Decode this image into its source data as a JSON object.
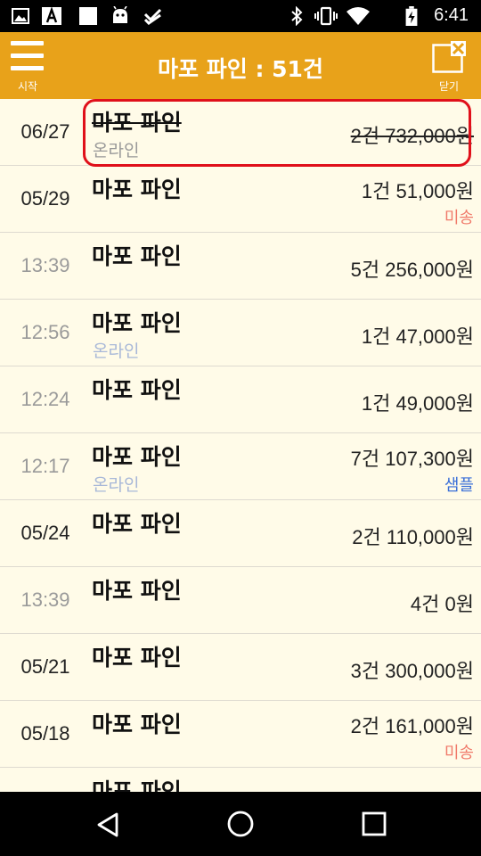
{
  "header": {
    "menu_caption": "시작",
    "title": "마포 파인 : 51건",
    "close_caption": "닫기"
  },
  "status": {
    "time": "6:41"
  },
  "rows": [
    {
      "time": "06/27",
      "time_type": "date",
      "name": "마포 파인",
      "sub": "온라인",
      "amount": "2건 732,000원",
      "badge": "",
      "cancelled": true
    },
    {
      "time": "05/29",
      "time_type": "date",
      "name": "마포 파인",
      "sub": "",
      "amount": "1건 51,000원",
      "badge": "미송",
      "cancelled": false
    },
    {
      "time": "13:39",
      "time_type": "clock",
      "name": "마포 파인",
      "sub": "",
      "amount": "5건 256,000원",
      "badge": "",
      "cancelled": false
    },
    {
      "time": "12:56",
      "time_type": "clock",
      "name": "마포 파인",
      "sub": "온라인",
      "amount": "1건 47,000원",
      "badge": "",
      "cancelled": false
    },
    {
      "time": "12:24",
      "time_type": "clock",
      "name": "마포 파인",
      "sub": "",
      "amount": "1건 49,000원",
      "badge": "",
      "cancelled": false
    },
    {
      "time": "12:17",
      "time_type": "clock",
      "name": "마포 파인",
      "sub": "온라인",
      "amount": "7건 107,300원",
      "badge": "샘플",
      "cancelled": false
    },
    {
      "time": "05/24",
      "time_type": "date",
      "name": "마포 파인",
      "sub": "",
      "amount": "2건 110,000원",
      "badge": "",
      "cancelled": false
    },
    {
      "time": "13:39",
      "time_type": "clock",
      "name": "마포 파인",
      "sub": "",
      "amount": "4건 0원",
      "badge": "",
      "cancelled": false
    },
    {
      "time": "05/21",
      "time_type": "date",
      "name": "마포 파인",
      "sub": "",
      "amount": "3건 300,000원",
      "badge": "",
      "cancelled": false
    },
    {
      "time": "05/18",
      "time_type": "date",
      "name": "마포 파인",
      "sub": "",
      "amount": "2건 161,000원",
      "badge": "미송",
      "cancelled": false
    },
    {
      "time": "",
      "time_type": "date",
      "name": "마포 파인",
      "sub": "",
      "amount": "",
      "badge": "",
      "cancelled": false
    }
  ],
  "colors": {
    "appbar": "#e8a21a",
    "background": "#fffbe8",
    "badge_unsent": "#f07a6a",
    "badge_sample": "#3a6fd8",
    "online": "#a8b8d8",
    "highlight": "#e0101a"
  },
  "icons": {
    "status_left": [
      "image-icon",
      "font-a-icon",
      "blank-square-icon",
      "android-icon",
      "check-icon"
    ],
    "status_right": [
      "bluetooth-icon",
      "vibrate-icon",
      "wifi-icon",
      "battery-charging-icon"
    ],
    "nav": [
      "back-icon",
      "home-icon",
      "recents-icon"
    ]
  }
}
